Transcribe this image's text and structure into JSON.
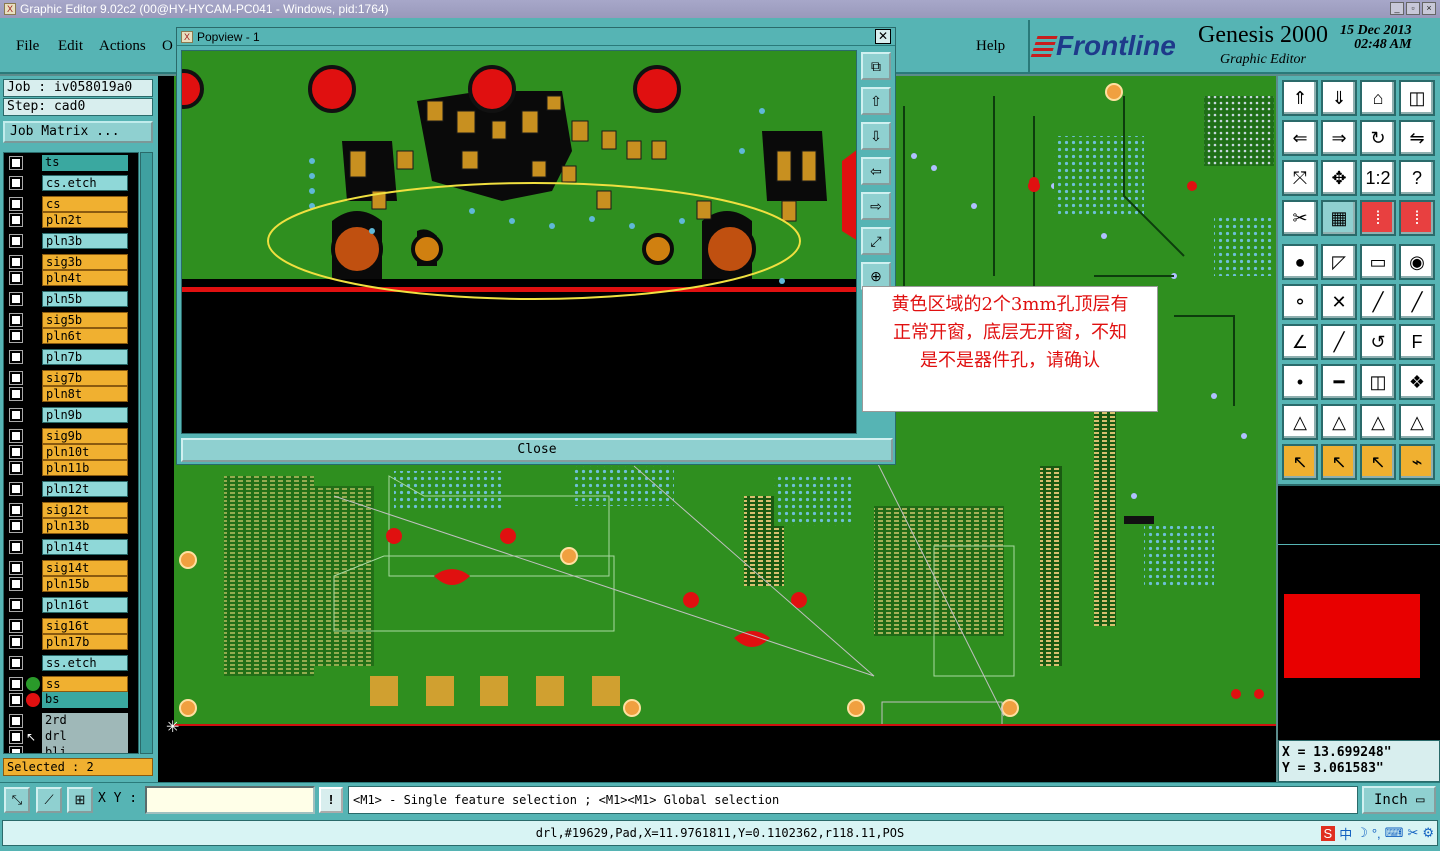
{
  "window": {
    "title": "Graphic Editor 9.02c2 (00@HY-HYCAM-PC041 - Windows, pid:1764)",
    "controls": [
      "_",
      "▫",
      "×"
    ]
  },
  "menu": {
    "items": [
      "File",
      "Edit",
      "Actions",
      "O"
    ],
    "help": "Help"
  },
  "brand": {
    "logo": "Frontline",
    "product": "Genesis 2000",
    "subtitle": "Graphic Editor",
    "date": "15 Dec 2013",
    "time": "02:48 AM"
  },
  "job": {
    "job_label": "Job : iv058019a0",
    "step_label": "Step: cad0",
    "matrix_button": "Job Matrix ..."
  },
  "layers": [
    {
      "name": "ts",
      "style": "dteal"
    },
    {
      "name": "cs.etch",
      "style": "teal"
    },
    {
      "name": "cs",
      "style": "orange"
    },
    {
      "name": "pln2t",
      "style": "orange"
    },
    {
      "name": "pln3b",
      "style": "teal"
    },
    {
      "name": "sig3b",
      "style": "orange"
    },
    {
      "name": "pln4t",
      "style": "orange"
    },
    {
      "name": "pln5b",
      "style": "teal"
    },
    {
      "name": "sig5b",
      "style": "orange"
    },
    {
      "name": "pln6t",
      "style": "orange"
    },
    {
      "name": "pln7b",
      "style": "teal"
    },
    {
      "name": "sig7b",
      "style": "orange"
    },
    {
      "name": "pln8t",
      "style": "orange"
    },
    {
      "name": "pln9b",
      "style": "teal"
    },
    {
      "name": "sig9b",
      "style": "orange"
    },
    {
      "name": "pln10t",
      "style": "orange"
    },
    {
      "name": "pln11b",
      "style": "orange"
    },
    {
      "name": "pln12t",
      "style": "teal"
    },
    {
      "name": "sig12t",
      "style": "orange"
    },
    {
      "name": "pln13b",
      "style": "orange"
    },
    {
      "name": "pln14t",
      "style": "teal"
    },
    {
      "name": "sig14t",
      "style": "orange"
    },
    {
      "name": "pln15b",
      "style": "orange"
    },
    {
      "name": "pln16t",
      "style": "teal"
    },
    {
      "name": "sig16t",
      "style": "orange"
    },
    {
      "name": "pln17b",
      "style": "orange"
    },
    {
      "name": "ss.etch",
      "style": "teal"
    },
    {
      "name": "ss",
      "style": "orange",
      "dot": "#2a9a2a"
    },
    {
      "name": "bs",
      "style": "dteal",
      "dot": "#e01010"
    },
    {
      "name": "2rd",
      "style": "grey"
    },
    {
      "name": "drl",
      "style": "grey",
      "work": true
    },
    {
      "name": "bli",
      "style": "grey"
    }
  ],
  "selected": "Selected : 2",
  "popview": {
    "title": "Popview - 1",
    "close": "Close",
    "tools": [
      "⧉",
      "⇧",
      "⇩",
      "⇦",
      "⇨",
      "⤢",
      "⊕"
    ]
  },
  "annotation": {
    "line1": "黄色区域的2个3mm孔顶层有",
    "line2": "正常开窗，底层无开窗，不知",
    "line3": "是不是器件孔，请确认"
  },
  "toolbar": {
    "icons": [
      "up-icon",
      "down-icon",
      "home-icon",
      "split-icon",
      "left-icon",
      "right-icon",
      "rotate-icon",
      "mirror-icon",
      "fit-icon",
      "center-icon",
      "scale-icon",
      "help-icon",
      "measure-icon",
      "grid-icon",
      "snap-icon",
      "snap2-icon",
      "pad-icon",
      "pencil-icon",
      "ruler-icon",
      "dot-icon",
      "connect-icon",
      "cross-icon",
      "line-icon",
      "line2-icon",
      "angle-icon",
      "slash-icon",
      "arc-icon",
      "ff-icon",
      "pad2-icon",
      "minus-icon",
      "resize-icon",
      "group-icon",
      "triangle-icon",
      "triangle2-icon",
      "triangle3-icon",
      "triangle4-icon",
      "pointer-icon",
      "pointer2-icon",
      "pointer3-icon",
      "route-icon"
    ],
    "labels": [
      "⇑",
      "⇓",
      "⌂",
      "◫",
      "⇐",
      "⇒",
      "↻",
      "⇋",
      "⤧",
      "✥",
      "1:2",
      "?",
      "✂",
      "▦",
      "⁞",
      "⁞",
      "●",
      "◸",
      "▭",
      "◉",
      "⚬",
      "✕",
      "╱",
      "╱",
      "∠",
      "╱",
      "↺",
      "F",
      "•",
      "━",
      "◫",
      "❖",
      "△",
      "△",
      "△",
      "△",
      "↖",
      "↖",
      "↖",
      "⌁"
    ]
  },
  "coords": {
    "x": "X = 13.699248\"",
    "y": "Y = 3.061583\""
  },
  "command": {
    "xy_label": "X Y :",
    "xy_value": "",
    "bang": "!",
    "message": "<M1> - Single feature selection ; <M1><M1> Global selection",
    "units": "Inch"
  },
  "status": "drl,#19629,Pad,X=11.9761811,Y=0.1102362,r118.11,POS",
  "ime": [
    "S",
    "中",
    "☽",
    "°,",
    "⌨",
    "✂",
    "⚙"
  ]
}
